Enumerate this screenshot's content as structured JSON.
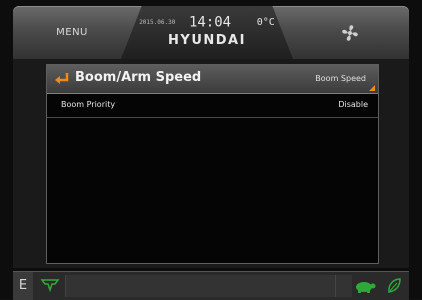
{
  "header": {
    "menu_label": "MENU",
    "date_small": "2015.06.30",
    "time": "14:04",
    "temperature": "0°C",
    "brand": "HYUNDAI",
    "fan_icon": "fan-icon"
  },
  "dialog": {
    "title": "Boom/Arm Speed",
    "dropdown_value": "Boom Speed",
    "back_icon": "back-arrow-icon",
    "rows": [
      {
        "label": "Boom Priority",
        "value": "Disable"
      }
    ]
  },
  "status_bar": {
    "mode_letter": "E",
    "icons": [
      "hydraulic-warning-icon",
      "tortoise-icon",
      "eco-leaf-icon"
    ]
  },
  "colors": {
    "accent_orange": "#f28a18",
    "status_green": "#2faa3a"
  }
}
